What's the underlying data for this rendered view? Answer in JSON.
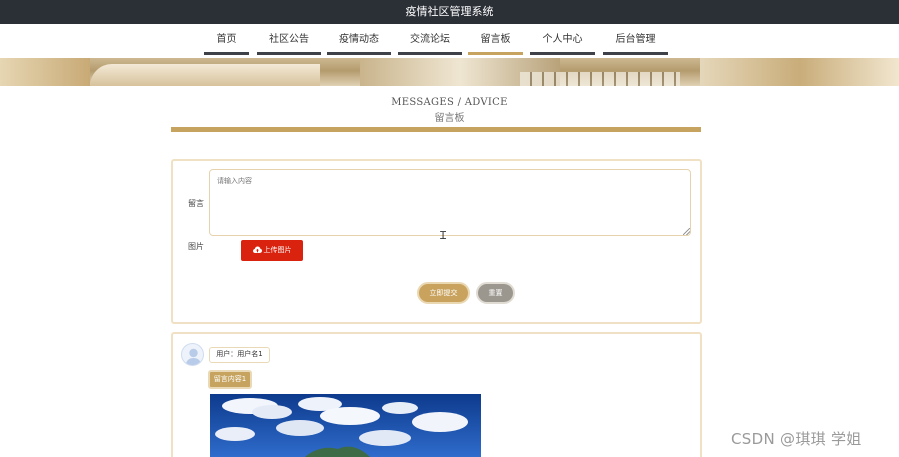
{
  "app": {
    "title": "疫情社区管理系统"
  },
  "nav": {
    "items": [
      {
        "label": "首页",
        "active": false
      },
      {
        "label": "社区公告",
        "active": false
      },
      {
        "label": "疫情动态",
        "active": false
      },
      {
        "label": "交流论坛",
        "active": false
      },
      {
        "label": "留言板",
        "active": true
      },
      {
        "label": "个人中心",
        "active": false
      },
      {
        "label": "后台管理",
        "active": false
      }
    ]
  },
  "page": {
    "heading_en": "MESSAGES / ADVICE",
    "heading_cn": "留言板"
  },
  "form": {
    "message_label": "留言",
    "message_placeholder": "请输入内容",
    "image_label": "图片",
    "upload_button": "上传图片",
    "submit_button": "立即提交",
    "reset_button": "重置"
  },
  "messages": [
    {
      "user": "用户：用户名1",
      "content": "留言内容1"
    }
  ],
  "watermark": "CSDN @琪琪 学姐",
  "colors": {
    "accent": "#c6a45f",
    "topbar": "#2b2f36",
    "upload": "#d9230f",
    "reset": "#9b968e"
  }
}
